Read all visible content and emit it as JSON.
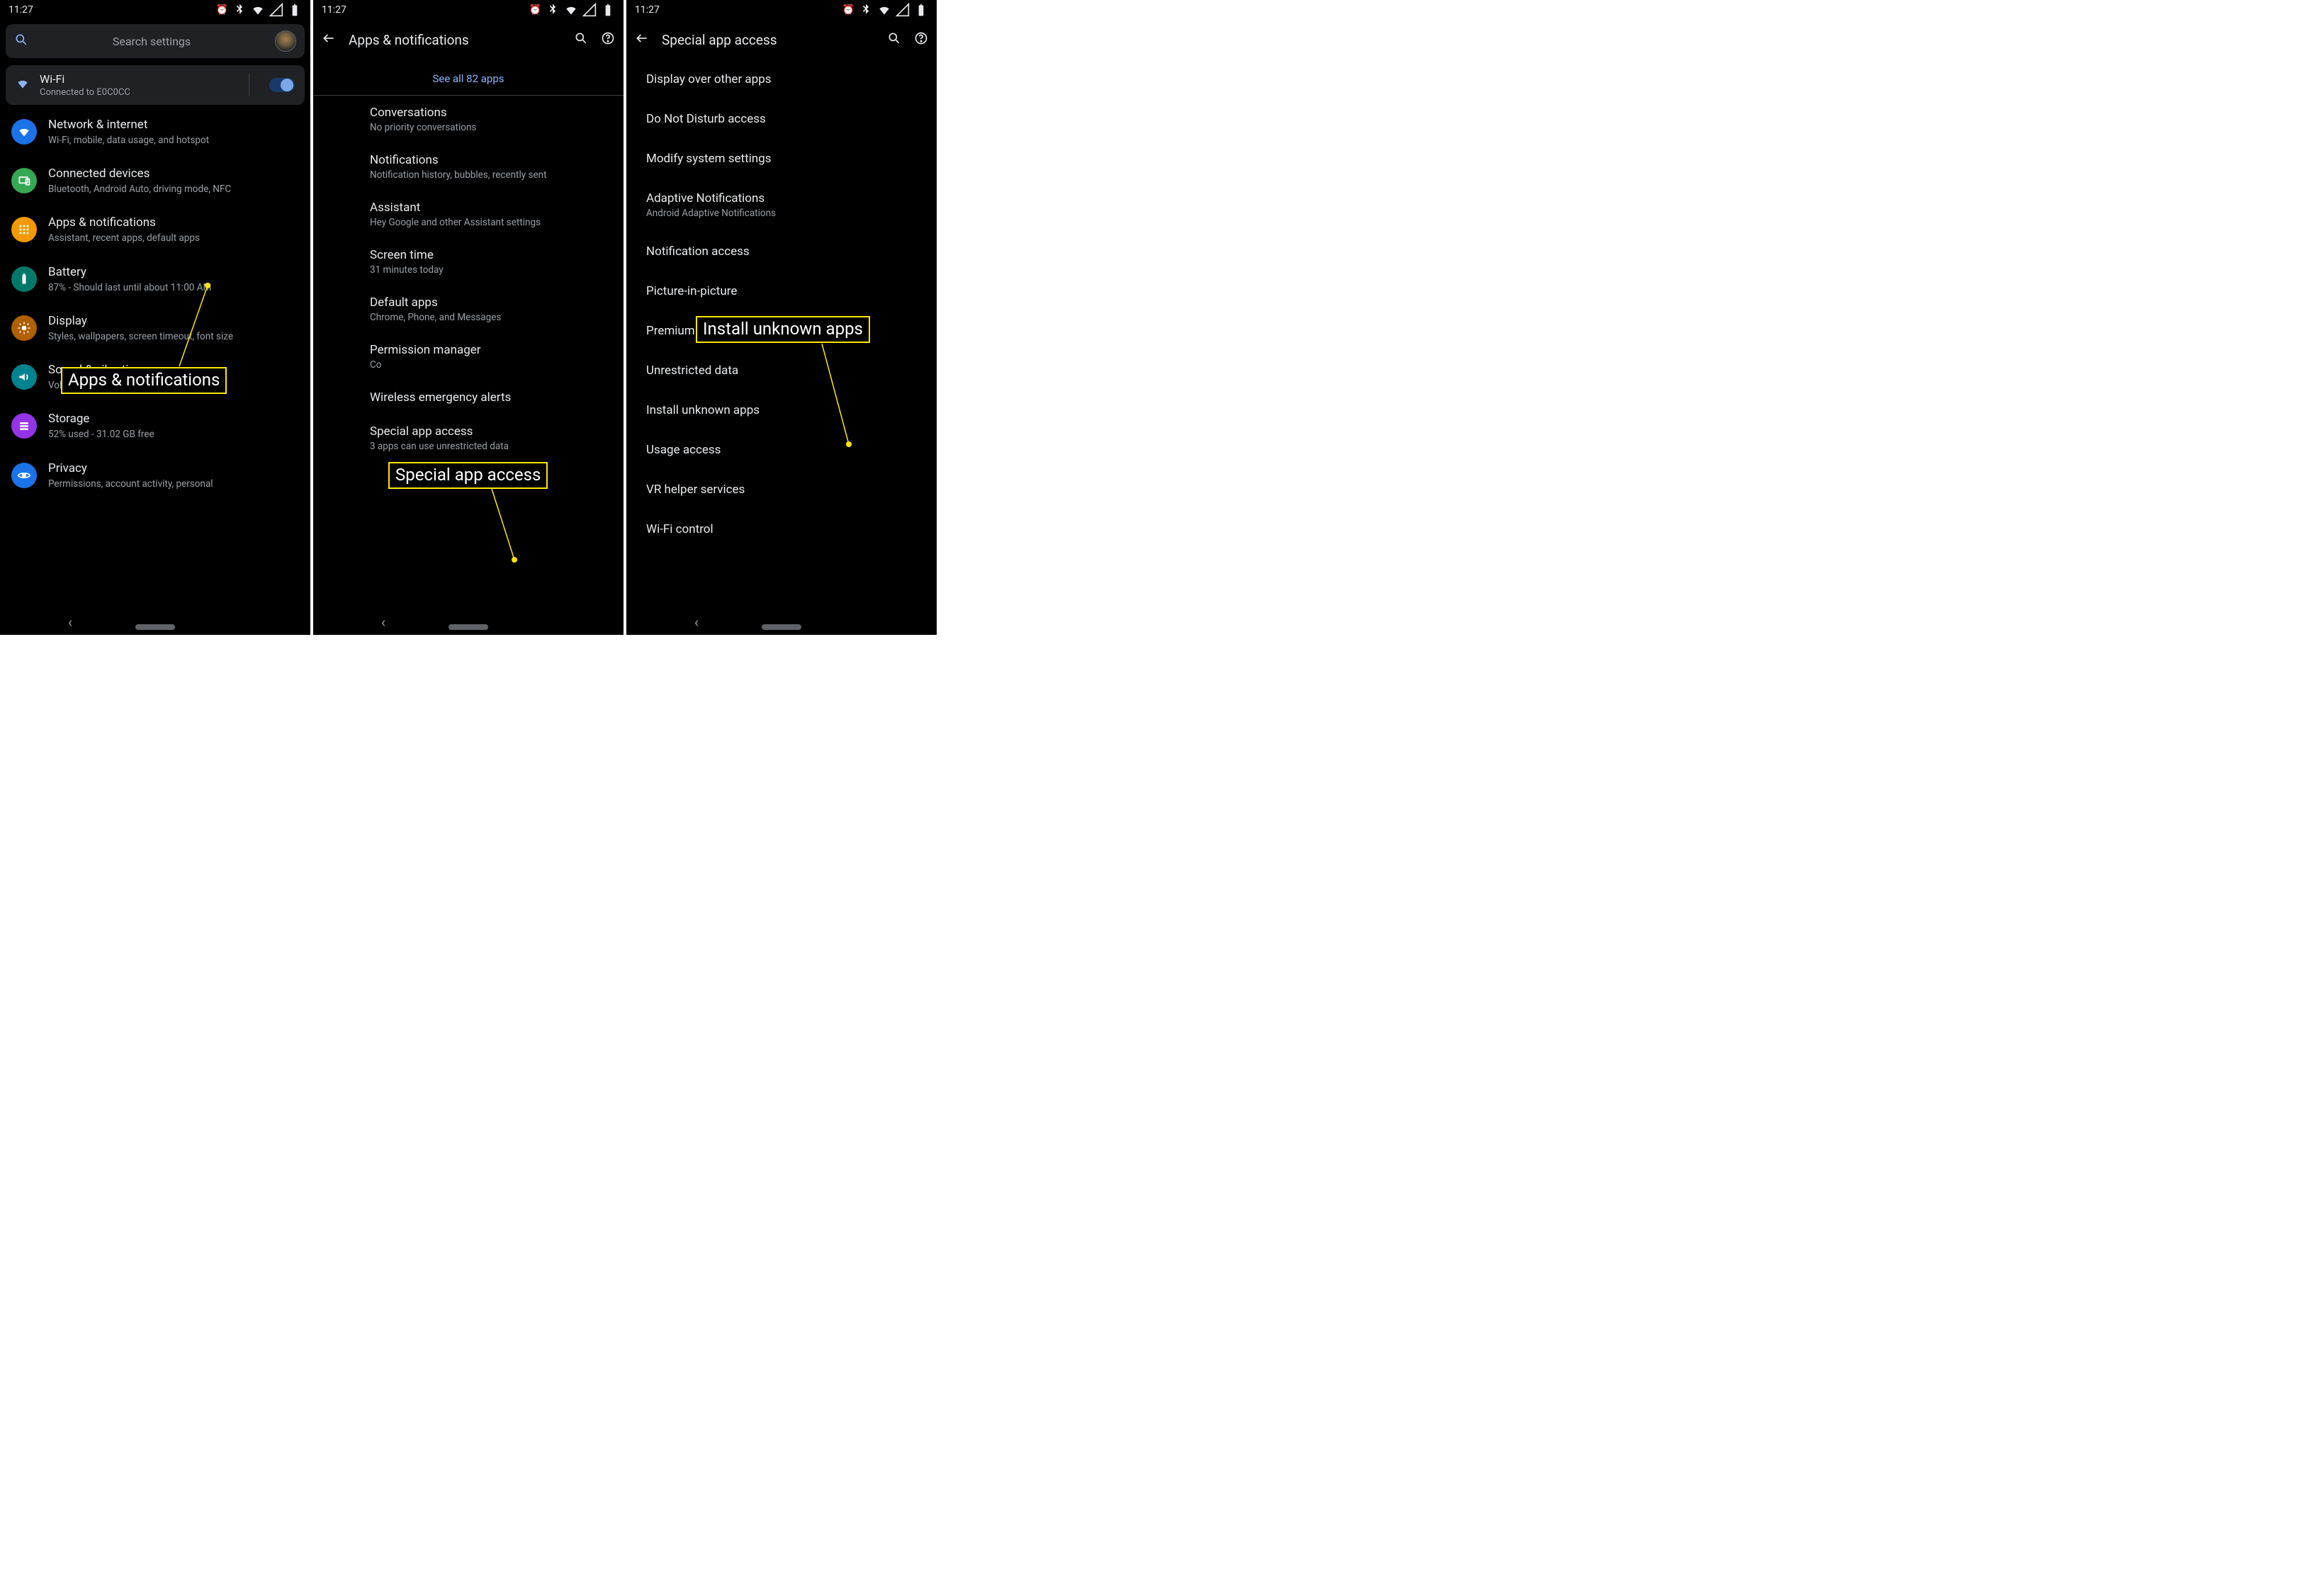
{
  "status_bar": {
    "time": "11:27",
    "icons": [
      "alarm",
      "bluetooth",
      "wifi",
      "signal",
      "battery"
    ]
  },
  "screen1": {
    "search_placeholder": "Search settings",
    "wifi_tile": {
      "title": "Wi-Fi",
      "subtitle": "Connected to E0C0CC",
      "on": true
    },
    "items": [
      {
        "key": "network",
        "color": "c-blue",
        "icon": "wifi",
        "title": "Network & internet",
        "sub": "Wi-Fi, mobile, data usage, and hotspot"
      },
      {
        "key": "devices",
        "color": "c-green",
        "icon": "devices",
        "title": "Connected devices",
        "sub": "Bluetooth, Android Auto, driving mode, NFC"
      },
      {
        "key": "apps",
        "color": "c-orange",
        "icon": "apps",
        "title": "Apps & notifications",
        "sub": "Assistant, recent apps, default apps"
      },
      {
        "key": "battery",
        "color": "c-teal",
        "icon": "battery",
        "title": "Battery",
        "sub": "87% - Should last until about 11:00 AM"
      },
      {
        "key": "display",
        "color": "c-amber",
        "icon": "brightness",
        "title": "Display",
        "sub": "Styles, wallpapers, screen timeout, font size"
      },
      {
        "key": "sound",
        "color": "c-teal2",
        "icon": "volume",
        "title": "Sound & vibration",
        "sub": "Volume, haptics, Do Not Disturb"
      },
      {
        "key": "storage",
        "color": "c-purple",
        "icon": "storage",
        "title": "Storage",
        "sub": "52% used - 31.02 GB free"
      },
      {
        "key": "privacy",
        "color": "c-blue2",
        "icon": "privacy",
        "title": "Privacy",
        "sub": "Permissions, account activity, personal"
      }
    ],
    "callout": "Apps & notifications"
  },
  "screen2": {
    "title": "Apps & notifications",
    "see_all": "See all 82 apps",
    "items": [
      {
        "title": "Conversations",
        "sub": "No priority conversations"
      },
      {
        "title": "Notifications",
        "sub": "Notification history, bubbles, recently sent"
      },
      {
        "title": "Assistant",
        "sub": "Hey Google and other Assistant settings"
      },
      {
        "title": "Screen time",
        "sub": "31 minutes today"
      },
      {
        "title": "Default apps",
        "sub": "Chrome, Phone, and Messages"
      },
      {
        "title": "Permission manager",
        "sub": "Co"
      },
      {
        "title": "Wireless emergency alerts",
        "sub": ""
      },
      {
        "title": "Special app access",
        "sub": "3 apps can use unrestricted data"
      }
    ],
    "callout": "Special app access"
  },
  "screen3": {
    "title": "Special app access",
    "items": [
      {
        "title": "Display over other apps",
        "sub": ""
      },
      {
        "title": "Do Not Disturb access",
        "sub": ""
      },
      {
        "title": "Modify system settings",
        "sub": ""
      },
      {
        "title": "Adaptive Notifications",
        "sub": "Android Adaptive Notifications"
      },
      {
        "title": "Notification access",
        "sub": ""
      },
      {
        "title": "Picture-in-picture",
        "sub": ""
      },
      {
        "title": "Premium SMS access",
        "sub": ""
      },
      {
        "title": "Unrestricted data",
        "sub": ""
      },
      {
        "title": "Install unknown apps",
        "sub": ""
      },
      {
        "title": "Usage access",
        "sub": ""
      },
      {
        "title": "VR helper services",
        "sub": ""
      },
      {
        "title": "Wi-Fi control",
        "sub": ""
      }
    ],
    "callout": "Install unknown apps"
  }
}
